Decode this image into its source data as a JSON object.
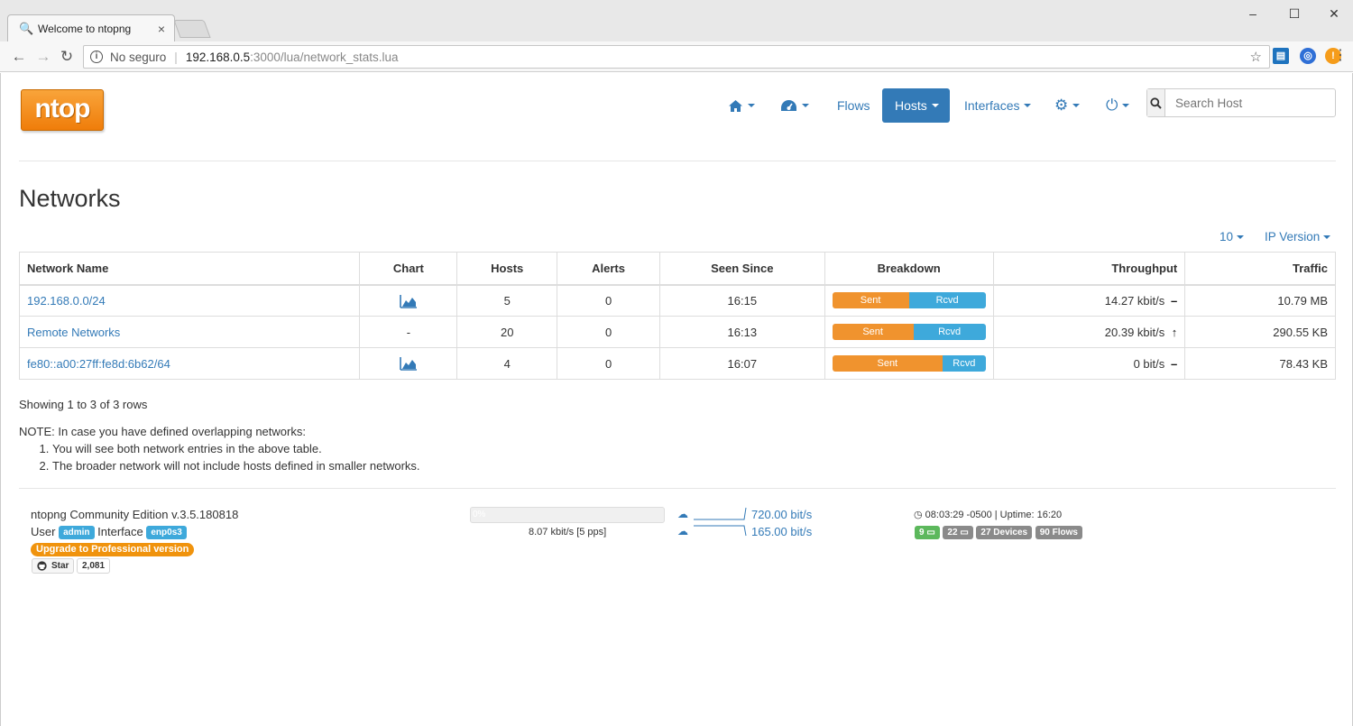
{
  "browser": {
    "tab_title": "Welcome to ntopng",
    "security_label": "No seguro",
    "url_host": "192.168.0.5",
    "url_path": ":3000/lua/network_stats.lua"
  },
  "nav": {
    "flows_label": "Flows",
    "hosts_label": "Hosts",
    "interfaces_label": "Interfaces",
    "search_placeholder": "Search Host"
  },
  "page": {
    "title": "Networks",
    "page_size": "10",
    "ip_version_label": "IP Version"
  },
  "table": {
    "headers": [
      "Network Name",
      "Chart",
      "Hosts",
      "Alerts",
      "Seen Since",
      "Breakdown",
      "Throughput",
      "Traffic"
    ],
    "rows": [
      {
        "name": "192.168.0.0/24",
        "chart": "icon",
        "hosts": "5",
        "alerts": "0",
        "seen_since": "16:15",
        "sent_label": "Sent",
        "rcvd_label": "Rcvd",
        "sent_fraction": 0.5,
        "throughput": "14.27 kbit/s",
        "trend": "flat",
        "traffic": "10.79 MB"
      },
      {
        "name": "Remote Networks",
        "chart": "-",
        "hosts": "20",
        "alerts": "0",
        "seen_since": "16:13",
        "sent_label": "Sent",
        "rcvd_label": "Rcvd",
        "sent_fraction": 0.53,
        "throughput": "20.39 kbit/s",
        "trend": "up",
        "traffic": "290.55 KB"
      },
      {
        "name": "fe80::a00:27ff:fe8d:6b62/64",
        "chart": "icon",
        "hosts": "4",
        "alerts": "0",
        "seen_since": "16:07",
        "sent_label": "Sent",
        "rcvd_label": "Rcvd",
        "sent_fraction": 0.72,
        "throughput": "0 bit/s",
        "trend": "flat",
        "traffic": "78.43 KB"
      }
    ],
    "rows_info": "Showing 1 to 3 of 3 rows"
  },
  "note": {
    "heading": "NOTE: In case you have defined overlapping networks:",
    "items": [
      "You will see both network entries in the above table.",
      "The broader network will not include hosts defined in smaller networks."
    ]
  },
  "footer": {
    "edition": "ntopng Community Edition v.3.5.180818",
    "user_label": "User",
    "user": "admin",
    "interface_label": "Interface",
    "interface": "enp0s3",
    "upgrade": "Upgrade to Professional version",
    "star_label": "Star",
    "star_count": "2,081",
    "progress_label": "0%",
    "progress_value": 0,
    "rate": "8.07 kbit/s [5 pps]",
    "upload": "720.00 bit/s",
    "download": "165.00 bit/s",
    "clock": "08:03:29 -0500 | Uptime: 16:20",
    "badge_local": "9",
    "badge_remote": "22",
    "badge_devices": "27 Devices",
    "badge_flows": "90 Flows"
  },
  "colors": {
    "link": "#337ab7",
    "sent": "#f0932e",
    "rcvd": "#3ea9db",
    "logo": "#f7931e"
  }
}
